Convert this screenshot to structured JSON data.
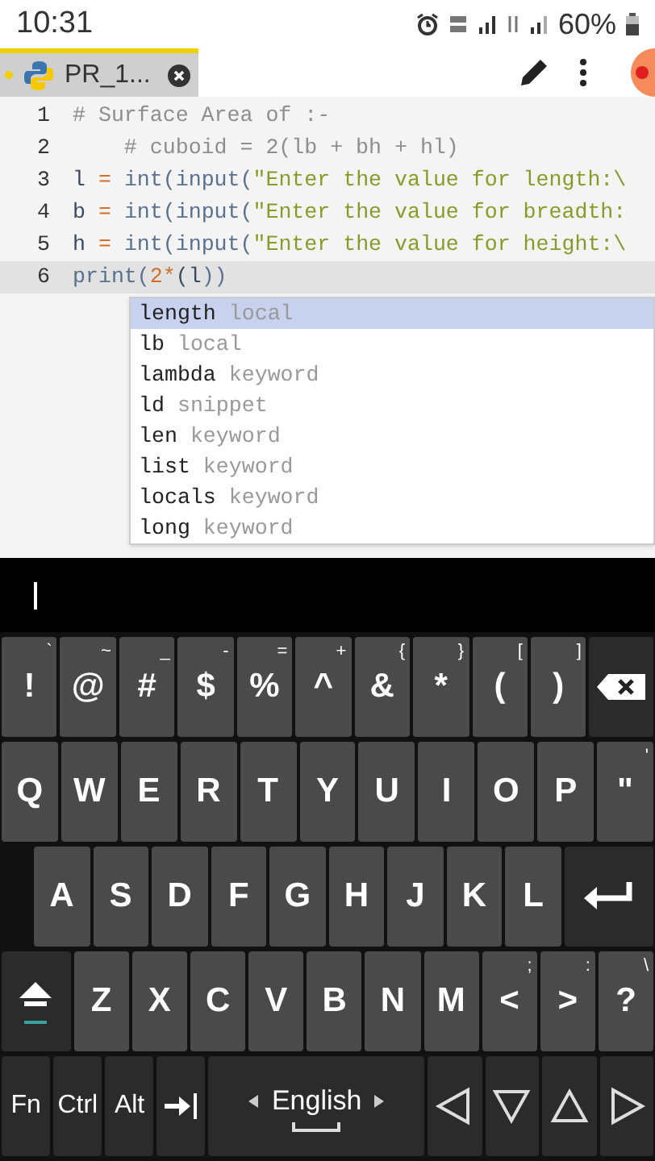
{
  "status_bar": {
    "time": "10:31",
    "battery": "60%"
  },
  "tabs": [
    {
      "label": "PR_1...",
      "selected": true,
      "modified": true
    }
  ],
  "editor": {
    "lines": [
      {
        "number": "1",
        "current": false,
        "tokens": [
          {
            "kind": "comment",
            "text": "# Surface Area of :-"
          }
        ]
      },
      {
        "number": "2",
        "current": false,
        "tokens": [
          {
            "kind": "comment",
            "text": "    # cuboid = 2(lb + bh + hl)"
          }
        ]
      },
      {
        "number": "3",
        "current": false,
        "tokens": [
          {
            "kind": "name",
            "text": "l"
          },
          {
            "kind": "op",
            "text": " = "
          },
          {
            "kind": "func",
            "text": "int(input("
          },
          {
            "kind": "string",
            "text": "\"Enter the value for length:\\"
          }
        ]
      },
      {
        "number": "4",
        "current": false,
        "tokens": [
          {
            "kind": "name",
            "text": "b"
          },
          {
            "kind": "op",
            "text": " = "
          },
          {
            "kind": "func",
            "text": "int(input("
          },
          {
            "kind": "string",
            "text": "\"Enter the value for breadth:"
          }
        ]
      },
      {
        "number": "5",
        "current": false,
        "tokens": [
          {
            "kind": "name",
            "text": "h"
          },
          {
            "kind": "op",
            "text": " = "
          },
          {
            "kind": "func",
            "text": "int(input("
          },
          {
            "kind": "string",
            "text": "\"Enter the value for height:\\"
          }
        ]
      },
      {
        "number": "6",
        "current": true,
        "tokens": [
          {
            "kind": "func",
            "text": "print("
          },
          {
            "kind": "number",
            "text": "2*"
          },
          {
            "kind": "name",
            "text": "(l"
          },
          {
            "kind": "func",
            "text": "))"
          }
        ]
      }
    ],
    "completions": [
      {
        "label": "length",
        "detail": "local",
        "selected": true
      },
      {
        "label": "lb",
        "detail": "local",
        "selected": false
      },
      {
        "label": "lambda",
        "detail": "keyword",
        "selected": false
      },
      {
        "label": "ld",
        "detail": "snippet",
        "selected": false
      },
      {
        "label": "len",
        "detail": "keyword",
        "selected": false
      },
      {
        "label": "list",
        "detail": "keyword",
        "selected": false
      },
      {
        "label": "locals",
        "detail": "keyword",
        "selected": false
      },
      {
        "label": "long",
        "detail": "keyword",
        "selected": false
      }
    ]
  },
  "keyboard": {
    "rows": [
      {
        "keys": [
          {
            "kind": "char",
            "label": "!",
            "sub": "`"
          },
          {
            "kind": "char",
            "label": "@",
            "sub": "~"
          },
          {
            "kind": "char",
            "label": "#",
            "sub": "_"
          },
          {
            "kind": "char",
            "label": "$",
            "sub": "-"
          },
          {
            "kind": "char",
            "label": "%",
            "sub": "="
          },
          {
            "kind": "char",
            "label": "^",
            "sub": "+"
          },
          {
            "kind": "char",
            "label": "&",
            "sub": "{"
          },
          {
            "kind": "char",
            "label": "*",
            "sub": "}"
          },
          {
            "kind": "char",
            "label": "(",
            "sub": "["
          },
          {
            "kind": "char",
            "label": ")",
            "sub": "]"
          },
          {
            "kind": "backspace"
          }
        ]
      },
      {
        "keys": [
          {
            "kind": "char",
            "label": "Q"
          },
          {
            "kind": "char",
            "label": "W"
          },
          {
            "kind": "char",
            "label": "E"
          },
          {
            "kind": "char",
            "label": "R"
          },
          {
            "kind": "char",
            "label": "T"
          },
          {
            "kind": "char",
            "label": "Y"
          },
          {
            "kind": "char",
            "label": "U"
          },
          {
            "kind": "char",
            "label": "I"
          },
          {
            "kind": "char",
            "label": "O"
          },
          {
            "kind": "char",
            "label": "P"
          },
          {
            "kind": "char",
            "label": "\"",
            "sub": "'"
          }
        ]
      },
      {
        "keys": [
          {
            "kind": "char",
            "label": "A"
          },
          {
            "kind": "char",
            "label": "S"
          },
          {
            "kind": "char",
            "label": "D"
          },
          {
            "kind": "char",
            "label": "F"
          },
          {
            "kind": "char",
            "label": "G"
          },
          {
            "kind": "char",
            "label": "H"
          },
          {
            "kind": "char",
            "label": "J"
          },
          {
            "kind": "char",
            "label": "K"
          },
          {
            "kind": "char",
            "label": "L"
          },
          {
            "kind": "enter"
          }
        ]
      },
      {
        "keys": [
          {
            "kind": "shift"
          },
          {
            "kind": "char",
            "label": "Z"
          },
          {
            "kind": "char",
            "label": "X"
          },
          {
            "kind": "char",
            "label": "C"
          },
          {
            "kind": "char",
            "label": "V"
          },
          {
            "kind": "char",
            "label": "B"
          },
          {
            "kind": "char",
            "label": "N"
          },
          {
            "kind": "char",
            "label": "M"
          },
          {
            "kind": "char",
            "label": "<",
            "sub": ";"
          },
          {
            "kind": "char",
            "label": ">",
            "sub": ":"
          },
          {
            "kind": "char",
            "label": "?",
            "sub": "\\"
          }
        ]
      },
      {
        "keys": [
          {
            "kind": "mod",
            "label": "Fn"
          },
          {
            "kind": "mod",
            "label": "Ctrl"
          },
          {
            "kind": "mod",
            "label": "Alt"
          },
          {
            "kind": "tab"
          },
          {
            "kind": "space",
            "label": "English"
          },
          {
            "kind": "arrow-left"
          },
          {
            "kind": "arrow-down"
          },
          {
            "kind": "arrow-up"
          },
          {
            "kind": "arrow-right"
          }
        ]
      }
    ]
  }
}
